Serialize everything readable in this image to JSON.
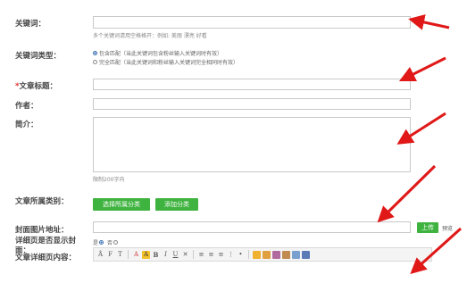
{
  "form": {
    "keyword": {
      "label": "关键词：",
      "value": "",
      "hint": "多个关键词请用空格格开：例如: 美丽 漂亮 好看"
    },
    "keyword_type": {
      "label": "关键词类型：",
      "option_contains": "包含匹配（当此关键词包含粉丝输入关键词时有效）",
      "option_exact": "完全匹配（当此关键词和粉丝输入关键词完全相同时有效）",
      "selected": "包含匹配"
    },
    "article_title": {
      "required_mark": "*",
      "label": "文章标题：",
      "value": ""
    },
    "author": {
      "label": "作者：",
      "value": ""
    },
    "summary": {
      "label": "简介：",
      "value": "",
      "limit_hint": "限制200字内"
    },
    "category": {
      "label": "文章所属类别：",
      "select_button": "选择所属分类",
      "add_button": "添加分类"
    },
    "cover_image": {
      "label": "封面图片地址：",
      "value": "",
      "upload_button": "上传",
      "preview_link": "预览"
    },
    "show_cover": {
      "label_line1": "详细页是否显示封",
      "label_line2": "面：",
      "option_yes": "是",
      "option_no": "否",
      "selected": "是"
    },
    "content": {
      "label": "文章详细页内容："
    }
  },
  "toolbar_icons": [
    "source-icon",
    "font-family-icon",
    "font-size-icon",
    "text-color-icon",
    "highlight-icon",
    "bold-icon",
    "italic-icon",
    "underline-icon",
    "eraser-icon",
    "align-left-icon",
    "align-center-icon",
    "align-right-icon",
    "ordered-list-icon",
    "unordered-list-icon",
    "emoticon-icon",
    "image-icon",
    "flash-icon",
    "media-icon",
    "table-icon",
    "link-icon"
  ],
  "colors": {
    "green_button": "#3fb33f",
    "required": "#e03030",
    "arrow": "#e01818"
  }
}
